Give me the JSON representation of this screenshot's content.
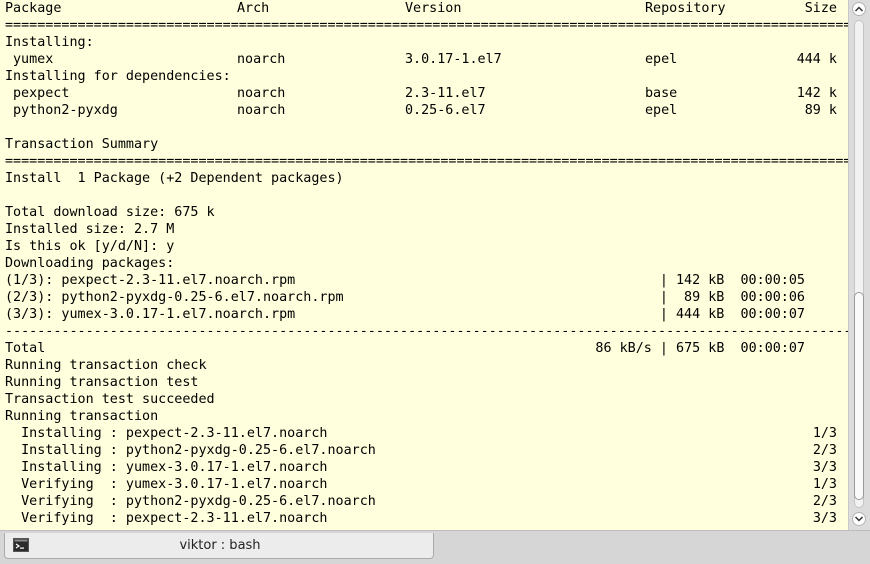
{
  "window": {
    "tab_label": "viktor : bash"
  },
  "icons": {
    "tab": "terminal-icon",
    "scroll_up": "chevron-up-icon",
    "scroll_down": "chevron-down-icon"
  },
  "colors": {
    "terminal_background": "#ffffdd",
    "terminal_text": "#000000"
  },
  "terminal": {
    "header": {
      "package": "Package",
      "arch": "Arch",
      "version": "Version",
      "repository": "Repository",
      "size": "Size"
    },
    "rule_double": "=====================================================================================================================================================================",
    "rule_dashed": "-----------------------------------------------------------------------------------------------------------------------------------------------------------------------------",
    "installing_heading": "Installing:",
    "installing_deps_heading": "Installing for dependencies:",
    "packages": [
      {
        "name": "yumex",
        "arch": "noarch",
        "version": "3.0.17-1.el7",
        "repo": "epel",
        "size": "444 k"
      },
      {
        "name": "pexpect",
        "arch": "noarch",
        "version": "2.3-11.el7",
        "repo": "base",
        "size": "142 k"
      },
      {
        "name": "python2-pyxdg",
        "arch": "noarch",
        "version": "0.25-6.el7",
        "repo": "epel",
        "size": "89 k"
      }
    ],
    "transaction_summary": "Transaction Summary",
    "install_summary": "Install  1 Package (+2 Dependent packages)",
    "total_download_size": "Total download size: 675 k",
    "installed_size": "Installed size: 2.7 M",
    "prompt": "Is this ok [y/d/N]: y",
    "downloading": "Downloading packages:",
    "downloads": [
      {
        "file": "(1/3): pexpect-2.3-11.el7.noarch.rpm",
        "stats": "| 142 kB  00:00:05"
      },
      {
        "file": "(2/3): python2-pyxdg-0.25-6.el7.noarch.rpm",
        "stats": "|  89 kB  00:00:06"
      },
      {
        "file": "(3/3): yumex-3.0.17-1.el7.noarch.rpm",
        "stats": "| 444 kB  00:00:07"
      }
    ],
    "total_label": "Total",
    "total_stats": "86 kB/s | 675 kB  00:00:07",
    "status_lines": [
      "Running transaction check",
      "Running transaction test",
      "Transaction test succeeded",
      "Running transaction"
    ],
    "steps": [
      {
        "text": "  Installing : pexpect-2.3-11.el7.noarch",
        "count": "1/3"
      },
      {
        "text": "  Installing : python2-pyxdg-0.25-6.el7.noarch",
        "count": "2/3"
      },
      {
        "text": "  Installing : yumex-3.0.17-1.el7.noarch",
        "count": "3/3"
      },
      {
        "text": "  Verifying  : yumex-3.0.17-1.el7.noarch",
        "count": "1/3"
      },
      {
        "text": "  Verifying  : python2-pyxdg-0.25-6.el7.noarch",
        "count": "2/3"
      },
      {
        "text": "  Verifying  : pexpect-2.3-11.el7.noarch",
        "count": "3/3"
      }
    ]
  }
}
